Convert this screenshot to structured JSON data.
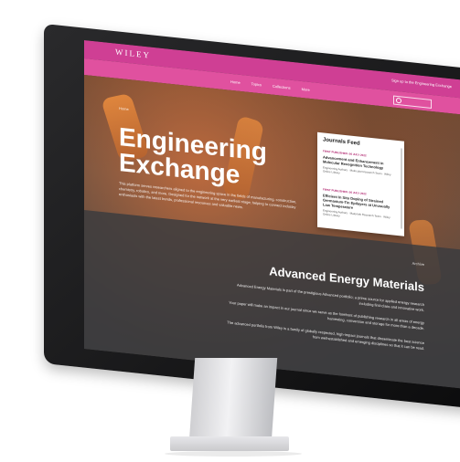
{
  "brand": {
    "logo": "WILEY"
  },
  "topbar": {
    "signin_text": "Sign up to the Engineering Exchange"
  },
  "nav": {
    "items": [
      "Home",
      "Topics",
      "Collections",
      "More"
    ],
    "search_placeholder": "Search"
  },
  "hero": {
    "breadcrumb": "Home",
    "title_line1": "Engineering",
    "title_line2": "Exchange",
    "description": "This platform serves researchers aligned to the engineering space in the fields of manufacturing, construction, chemistry, robotics, and more. Designed for the network at the very earliest stage; helping to connect industry enthusiasts with the latest trends, professional resources and valuable news."
  },
  "journals_feed": {
    "title": "Journals Feed",
    "items": [
      {
        "tag": "FIRST PUBLISHED: 06 JULY 2022",
        "headline": "Advancement and Enhancement in Molecular Recognition Technology",
        "authors": "Engineering Authors · Molecular Research Team · Wiley Online Library"
      },
      {
        "tag": "FIRST PUBLISHED: 06 JULY 2022",
        "headline": "Efficient In Situ Doping of Strained Germanium-Tin Epilayers at Unusually Low Temperature",
        "authors": "Engineering Authors · Materials Research Team · Wiley Online Library"
      }
    ]
  },
  "section": {
    "tag": "Archive",
    "title": "Advanced Energy Materials",
    "paragraphs": [
      "Advanced Energy Materials is part of the prestigious Advanced portfolio; a prime source for applied energy research including first-class and innovative work.",
      "Your paper will make an impact in our journal since we serve as the forefront of publishing research in all areas of energy harvesting, conversion and storage for more than a decade.",
      "The advanced portfolio from Wiley is a family of globally respected, high-impact journals that disseminate the best science from well-established and emerging disciplines so that it can be read."
    ]
  },
  "colors": {
    "topbar": "#cf3f94",
    "navbar": "#e0519f",
    "accent": "#b0266f",
    "bezel": "#0c0c0d"
  }
}
